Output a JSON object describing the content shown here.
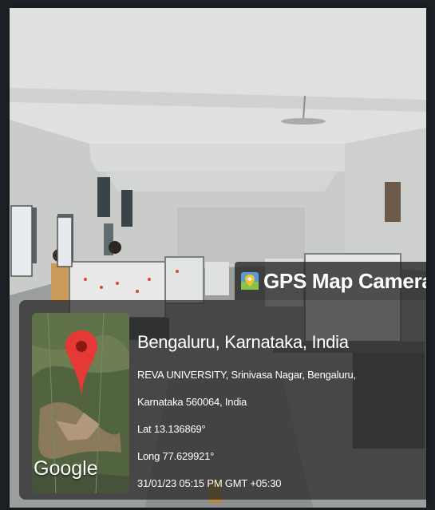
{
  "photo": {
    "description_icon": "photo-scene"
  },
  "app_tag": {
    "icon": "map-pin-icon",
    "name": "GPS Map Camera"
  },
  "location": {
    "title": "Bengaluru, Karnataka, India",
    "address_line1": "REVA UNIVERSITY, Srinivasa Nagar, Bengaluru,",
    "address_line2": "Karnataka 560064, India",
    "latitude": "Lat 13.136869°",
    "longitude": "Long 77.629921°",
    "timestamp": "31/01/23 05:15 PM GMT +05:30"
  },
  "map": {
    "brand": "Google",
    "marker_color": "#e53935"
  }
}
